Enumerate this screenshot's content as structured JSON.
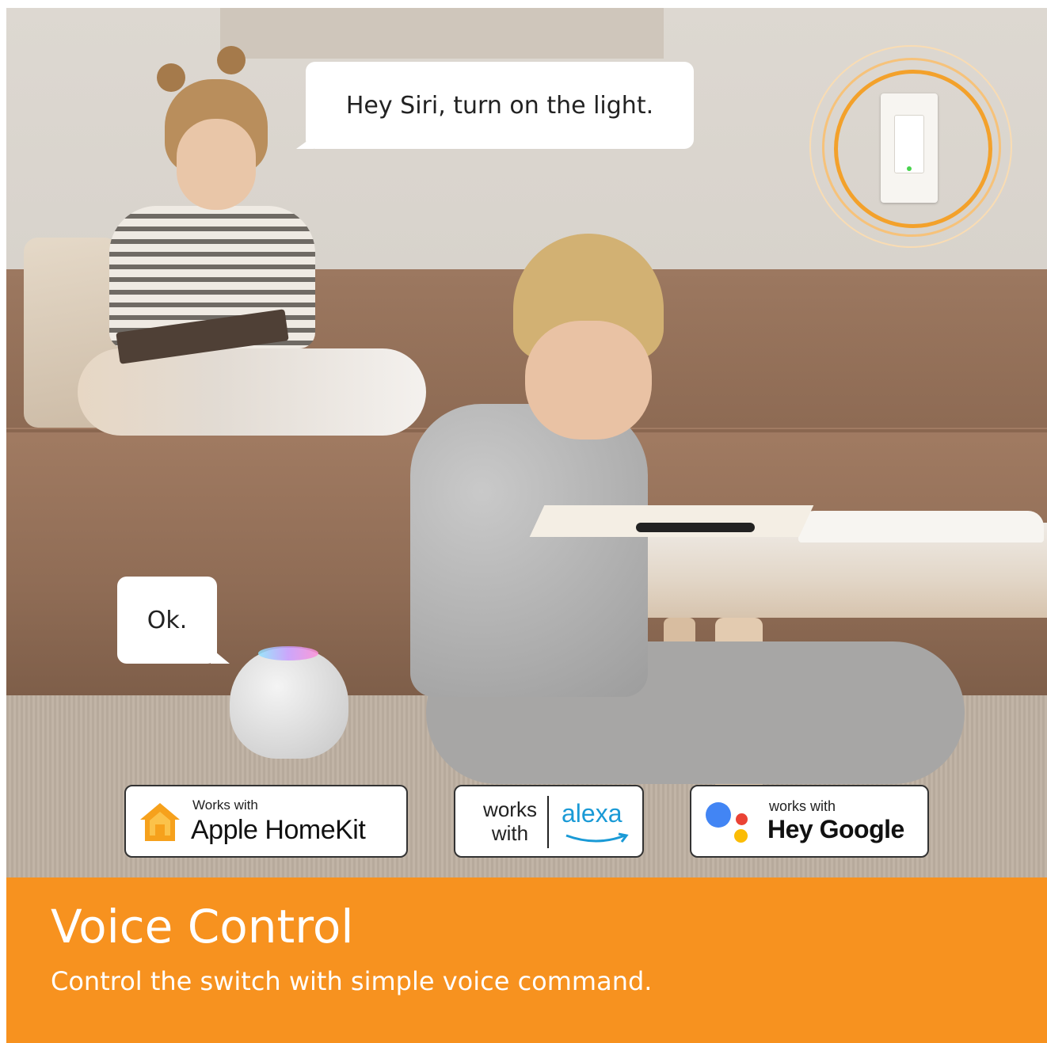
{
  "bubbles": {
    "siri": "Hey Siri, turn on the light.",
    "reply": "Ok."
  },
  "badges": {
    "homekit": {
      "small": "Works with",
      "big": "Apple HomeKit"
    },
    "alexa": {
      "works_line1": "works",
      "works_line2": "with",
      "brand": "alexa"
    },
    "google": {
      "small": "works with",
      "big": "Hey Google"
    }
  },
  "banner": {
    "title": "Voice Control",
    "subtitle": "Control the switch with simple voice command."
  },
  "colors": {
    "accent_orange": "#f7921f",
    "alexa_blue": "#1a9ad6",
    "google_blue": "#4285f4",
    "google_red": "#ea4335",
    "google_yellow": "#fbbc05"
  },
  "icons": [
    "home-icon",
    "alexa-smile-icon",
    "google-assistant-icon",
    "light-switch-icon",
    "smart-speaker-icon"
  ]
}
